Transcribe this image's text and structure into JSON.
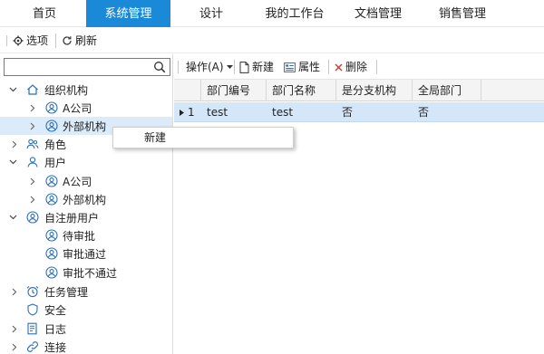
{
  "topnav": {
    "tabs": [
      {
        "label": "首页"
      },
      {
        "label": "系统管理"
      },
      {
        "label": "设计"
      },
      {
        "label": "我的工作台"
      },
      {
        "label": "文档管理"
      },
      {
        "label": "销售管理"
      }
    ],
    "active_tab": "系统管理"
  },
  "toolbar": {
    "options_label": "选项",
    "refresh_label": "刷新"
  },
  "search": {
    "value": "",
    "placeholder": ""
  },
  "tree": {
    "org": {
      "label": "组织机构",
      "children": [
        {
          "label": "A公司"
        },
        {
          "label": "外部机构"
        }
      ]
    },
    "role": {
      "label": "角色"
    },
    "user": {
      "label": "用户",
      "children": [
        {
          "label": "A公司"
        },
        {
          "label": "外部机构"
        }
      ]
    },
    "selfreg": {
      "label": "自注册用户",
      "children": [
        {
          "label": "待审批"
        },
        {
          "label": "审批通过"
        },
        {
          "label": "审批不通过"
        }
      ]
    },
    "task": {
      "label": "任务管理"
    },
    "security": {
      "label": "安全"
    },
    "log": {
      "label": "日志"
    },
    "conn": {
      "label": "连接"
    }
  },
  "grid_toolbar": {
    "action_label": "操作(A)",
    "new_label": "新建",
    "props_label": "属性",
    "delete_label": "删除"
  },
  "grid": {
    "columns": [
      "部门编号",
      "部门名称",
      "是分支机构",
      "全局部门"
    ],
    "rows": [
      {
        "index": "1",
        "cells": [
          "test",
          "test",
          "否",
          "否"
        ]
      }
    ]
  },
  "context_menu": {
    "items": [
      {
        "label": "新建"
      }
    ]
  },
  "colors": {
    "accent": "#1a8ad8",
    "selection": "#d3e7f9",
    "icon_blue": "#2a6fb5"
  }
}
